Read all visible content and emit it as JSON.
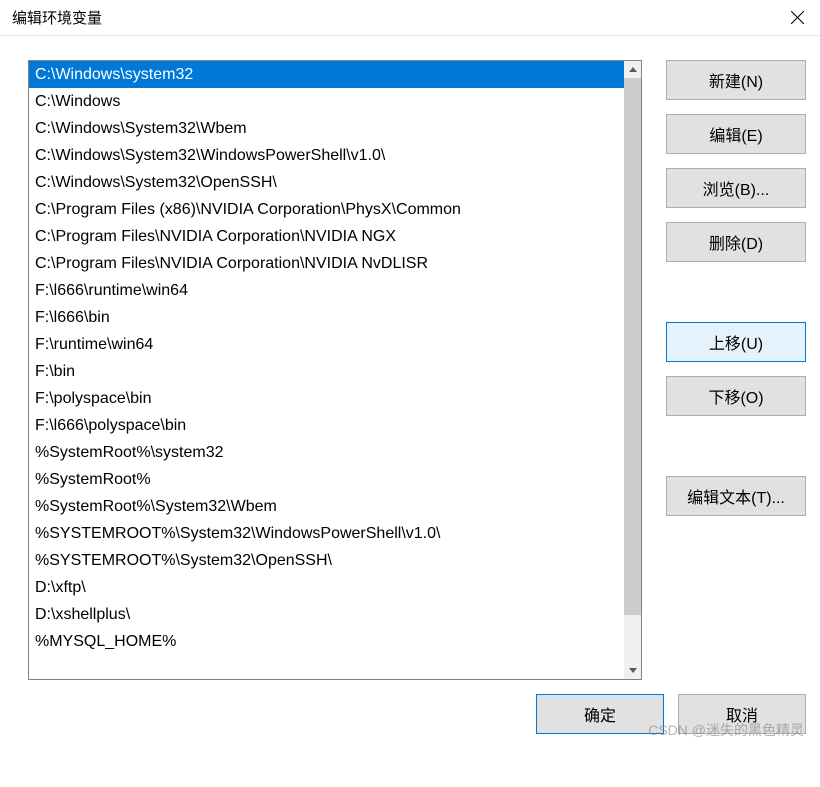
{
  "window": {
    "title": "编辑环境变量"
  },
  "list": {
    "selected_index": 0,
    "items": [
      "C:\\Windows\\system32",
      "C:\\Windows",
      "C:\\Windows\\System32\\Wbem",
      "C:\\Windows\\System32\\WindowsPowerShell\\v1.0\\",
      "C:\\Windows\\System32\\OpenSSH\\",
      "C:\\Program Files (x86)\\NVIDIA Corporation\\PhysX\\Common",
      "C:\\Program Files\\NVIDIA Corporation\\NVIDIA NGX",
      "C:\\Program Files\\NVIDIA Corporation\\NVIDIA NvDLISR",
      "F:\\l666\\runtime\\win64",
      "F:\\l666\\bin",
      "F:\\runtime\\win64",
      "F:\\bin",
      "F:\\polyspace\\bin",
      "F:\\l666\\polyspace\\bin",
      "%SystemRoot%\\system32",
      "%SystemRoot%",
      "%SystemRoot%\\System32\\Wbem",
      "%SYSTEMROOT%\\System32\\WindowsPowerShell\\v1.0\\",
      "%SYSTEMROOT%\\System32\\OpenSSH\\",
      "D:\\xftp\\",
      "D:\\xshellplus\\",
      "%MYSQL_HOME%"
    ]
  },
  "buttons": {
    "new": "新建(N)",
    "edit": "编辑(E)",
    "browse": "浏览(B)...",
    "delete": "删除(D)",
    "move_up": "上移(U)",
    "move_down": "下移(O)",
    "edit_text": "编辑文本(T)...",
    "ok": "确定",
    "cancel": "取消"
  },
  "watermark": "CSDN @迷失的黑色精灵"
}
